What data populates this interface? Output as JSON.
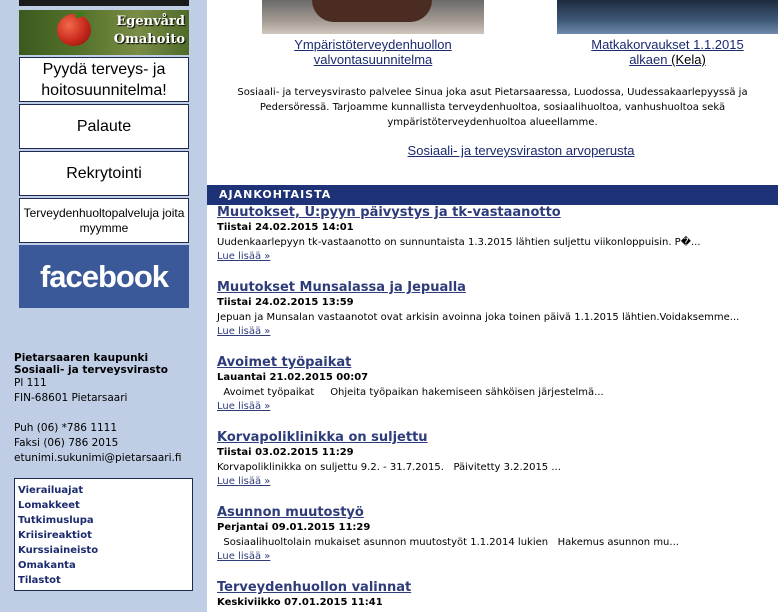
{
  "sidebar": {
    "banner_egenvard": {
      "line1": "Egenvård",
      "line2": "Omahoito"
    },
    "buttons": [
      {
        "label": "Pyydä terveys- ja hoitosuunnitelma!"
      },
      {
        "label": "Palaute"
      },
      {
        "label": "Rekrytointi"
      },
      {
        "label": "Terveydenhuoltopalveluja joita myymme"
      }
    ],
    "facebook_label": "facebook",
    "contact": {
      "org_line1": "Pietarsaaren kaupunki",
      "org_line2": "Sosiaali- ja terveysvirasto",
      "address1": "Pl 111",
      "address2": "FIN-68601 Pietarsaari",
      "phone": "Puh (06) *786 1111",
      "fax": "Faksi (06) 786 2015",
      "email": "etunimi.sukunimi@pietarsaari.fi"
    },
    "quick_links": [
      "Vierailuajat",
      "Lomakkeet",
      "Tutkimuslupa",
      "Kriisireaktiot",
      "Kurssiaineisto",
      "Omakanta",
      "Tilastot"
    ]
  },
  "main": {
    "featured": [
      {
        "title_line1": "Ympäristöterveydenhuollon",
        "title_line2": "valvontasuunnitelma"
      },
      {
        "title_line1": "Matkakorvaukset 1.1.2015",
        "title_line2": "alkaen",
        "suffix": "(Kela)"
      }
    ],
    "intro_line1": "Sosiaali- ja terveysvirasto palvelee Sinua joka asut Pietarsaaressa, Luodossa, Uudessakaarlepyyssä ja",
    "intro_line2": "Pedersöressä. Tarjoamme kunnallista terveydenhuoltoa, sosiaalihuoltoa, vanhushuoltoa sekä",
    "intro_line3": "ympäristöterveydenhuoltoa alueellamme.",
    "values_link": "Sosiaali- ja terveysviraston arvoperusta",
    "news_header": "AJANKOHTAISTA",
    "read_more": "Lue lisää »",
    "news": [
      {
        "title": "Muutokset, U:pyyn päivystys ja tk-vastaanotto",
        "date": "Tiistai 24.02.2015 14:01",
        "text": "Uudenkaarlepyyn tk-vastaanotto on sunnuntaista 1.3.2015 lähtien suljettu viikonloppuisin.  P�..."
      },
      {
        "title": "Muutokset Munsalassa ja Jepualla",
        "date": "Tiistai 24.02.2015 13:59",
        "text": "Jepuan ja Munsalan vastaanotot ovat arkisin avoinna joka toinen päivä 1.1.2015 lähtien.Voidaksemme..."
      },
      {
        "title": "Avoimet työpaikat",
        "date": "Lauantai 21.02.2015 00:07",
        "text": "  Avoimet työpaikat     Ohjeita työpaikan hakemiseen sähköisen järjestelmä..."
      },
      {
        "title": "Korvapoliklinikka on suljettu",
        "date": "Tiistai 03.02.2015 11:29",
        "text": "Korvapoliklinikka on suljettu 9.2. - 31.7.2015.   Päivitetty 3.2.2015 ..."
      },
      {
        "title": "Asunnon muutostyö",
        "date": "Perjantai 09.01.2015 11:29",
        "text": "  Sosiaalihuoltolain mukaiset asunnon muutostyöt 1.1.2014 lukien   Hakemus asunnon mu..."
      },
      {
        "title": "Terveydenhuollon valinnat",
        "date": "Keskiviikko 07.01.2015 11:41",
        "text": ""
      }
    ]
  }
}
